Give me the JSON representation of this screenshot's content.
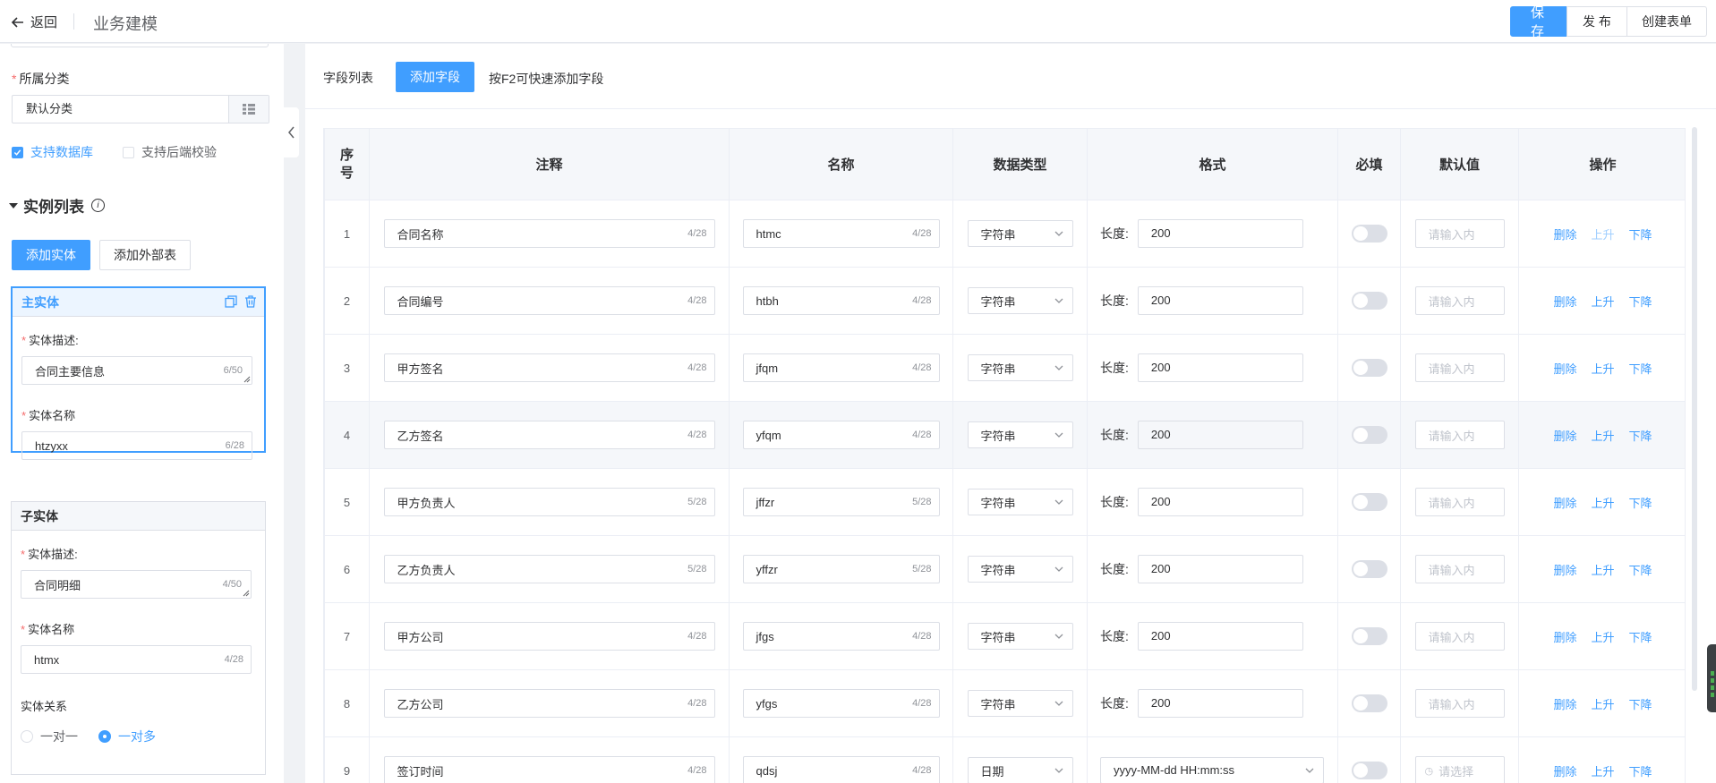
{
  "header": {
    "back_label": "返回",
    "title": "业务建模",
    "save_label": "保 存",
    "publish_label": "发 布",
    "create_form_label": "创建表单"
  },
  "left": {
    "category_label": "所属分类",
    "category_value": "默认分类",
    "support_db_label": "支持数据库",
    "support_db_checked": true,
    "backend_validate_label": "支持后端校验",
    "backend_validate_checked": false,
    "instance_section_title": "实例列表",
    "add_entity_label": "添加实体",
    "add_external_label": "添加外部表",
    "main_entity": {
      "title": "主实体",
      "desc_label": "实体描述:",
      "desc_value": "合同主要信息",
      "desc_count": "6/50",
      "name_label": "实体名称",
      "name_value": "htzyxx",
      "name_count": "6/28"
    },
    "sub_entity": {
      "title": "子实体",
      "desc_label": "实体描述:",
      "desc_value": "合同明细",
      "desc_count": "4/50",
      "name_label": "实体名称",
      "name_value": "htmx",
      "name_count": "4/28",
      "relation_label": "实体关系",
      "one_to_one": "一对一",
      "one_to_many": "一对多",
      "relation_selected": "一对多"
    }
  },
  "fields": {
    "title": "字段列表",
    "add_field_label": "添加字段",
    "hint": "按F2可快速添加字段",
    "columns": [
      "序号",
      "注释",
      "名称",
      "数据类型",
      "格式",
      "必填",
      "默认值",
      "操作"
    ],
    "length_label": "长度:",
    "default_placeholder": "请输入内",
    "date_placeholder": "请选择",
    "op_delete": "删除",
    "op_up": "上升",
    "op_down": "下降",
    "rows": [
      {
        "no": "1",
        "comment": "合同名称",
        "comment_count": "4/28",
        "name": "htmc",
        "name_count": "4/28",
        "type": "字符串",
        "length": "200"
      },
      {
        "no": "2",
        "comment": "合同编号",
        "comment_count": "4/28",
        "name": "htbh",
        "name_count": "4/28",
        "type": "字符串",
        "length": "200"
      },
      {
        "no": "3",
        "comment": "甲方签名",
        "comment_count": "4/28",
        "name": "jfqm",
        "name_count": "4/28",
        "type": "字符串",
        "length": "200"
      },
      {
        "no": "4",
        "comment": "乙方签名",
        "comment_count": "4/28",
        "name": "yfqm",
        "name_count": "4/28",
        "type": "字符串",
        "length": "200"
      },
      {
        "no": "5",
        "comment": "甲方负责人",
        "comment_count": "5/28",
        "name": "jffzr",
        "name_count": "5/28",
        "type": "字符串",
        "length": "200"
      },
      {
        "no": "6",
        "comment": "乙方负责人",
        "comment_count": "5/28",
        "name": "yffzr",
        "name_count": "5/28",
        "type": "字符串",
        "length": "200"
      },
      {
        "no": "7",
        "comment": "甲方公司",
        "comment_count": "4/28",
        "name": "jfgs",
        "name_count": "4/28",
        "type": "字符串",
        "length": "200"
      },
      {
        "no": "8",
        "comment": "乙方公司",
        "comment_count": "4/28",
        "name": "yfgs",
        "name_count": "4/28",
        "type": "字符串",
        "length": "200"
      },
      {
        "no": "9",
        "comment": "签订时间",
        "comment_count": "4/28",
        "name": "qdsj",
        "name_count": "4/28",
        "type": "日期",
        "date_format": "yyyy-MM-dd HH:mm:ss"
      }
    ]
  },
  "colors": {
    "primary": "#409eff",
    "disabled_link": "#a0cfff",
    "border": "#dcdfe6"
  }
}
